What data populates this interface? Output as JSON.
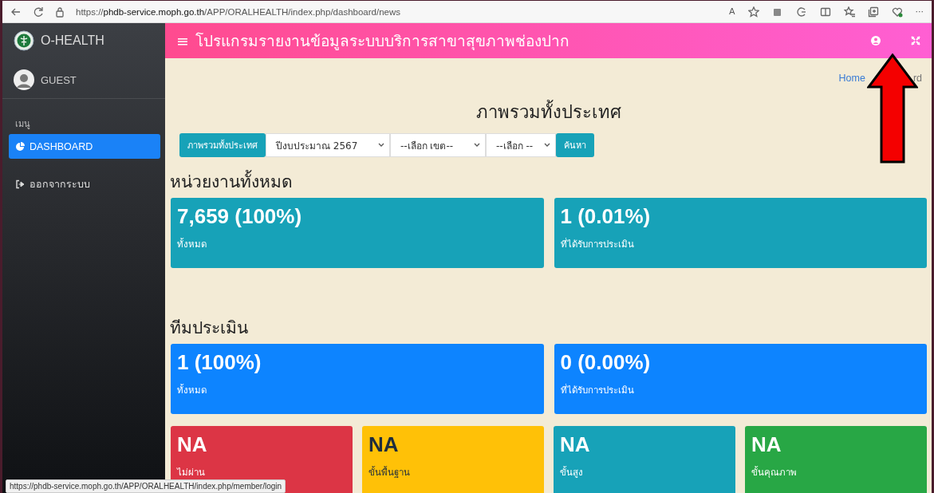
{
  "browser": {
    "url": "https://**phdb-service.moph.go.th**/APP/ORALHEALTH/index.php/dashboard/news",
    "reader_label": "A",
    "more": "···"
  },
  "sidebar": {
    "brand": "O-HEALTH",
    "user": "GUEST",
    "menu_heading": "เมนู",
    "items": [
      {
        "label": "DASHBOARD",
        "kind": "dashboard",
        "selected": true
      },
      {
        "label": "ออกจากระบบ",
        "kind": "logout",
        "selected": false
      }
    ]
  },
  "header": {
    "menu_icon": "≡",
    "title": "โปรแกรมรายงานข้อมูลระบบบริการสาขาสุขภาพช่องปาก"
  },
  "breadcrumb": [
    "Home",
    "rd"
  ],
  "page_title": "ภาพรวมทั้งประเทศ",
  "filters": {
    "overview_button": "ภาพรวมทั้งประเทศ",
    "selects": [
      "ปีงบประมาณ 2567",
      "--เลือก เขต--",
      "--เลือก --"
    ],
    "search_button": "ค้นหา"
  },
  "sections": [
    {
      "title": "หน่วยงานทั้งหมด",
      "cards": [
        {
          "value": "7,659 (100%)",
          "label": "ทั้งหมด",
          "color": "#17a2b8"
        },
        {
          "value": "1 (0.01%)",
          "label": "ที่ได้รับการประเมิน",
          "color": "#17a2b8"
        }
      ]
    },
    {
      "title": "ทีมประเมิน",
      "cards": [
        {
          "value": "1 (100%)",
          "label": "ทั้งหมด",
          "color": "#0d84ff"
        },
        {
          "value": "0 (0.00%)",
          "label": "ที่ได้รับการประเมิน",
          "color": "#0d84ff"
        }
      ]
    },
    {
      "cards": [
        {
          "value": "NA",
          "label": "ไม่ผ่าน",
          "color": "#dc3545"
        },
        {
          "value": "NA",
          "label": "ขั้นพื้นฐาน",
          "color": "#ffc107"
        },
        {
          "value": "NA",
          "label": "ขั้นสูง",
          "color": "#17a2b8"
        },
        {
          "value": "NA",
          "label": "ขั้นคุณภาพ",
          "color": "#28a745"
        }
      ]
    }
  ],
  "status_url": "https://phdb-service.moph.go.th/APP/ORALHEALTH/index.php/member/login"
}
